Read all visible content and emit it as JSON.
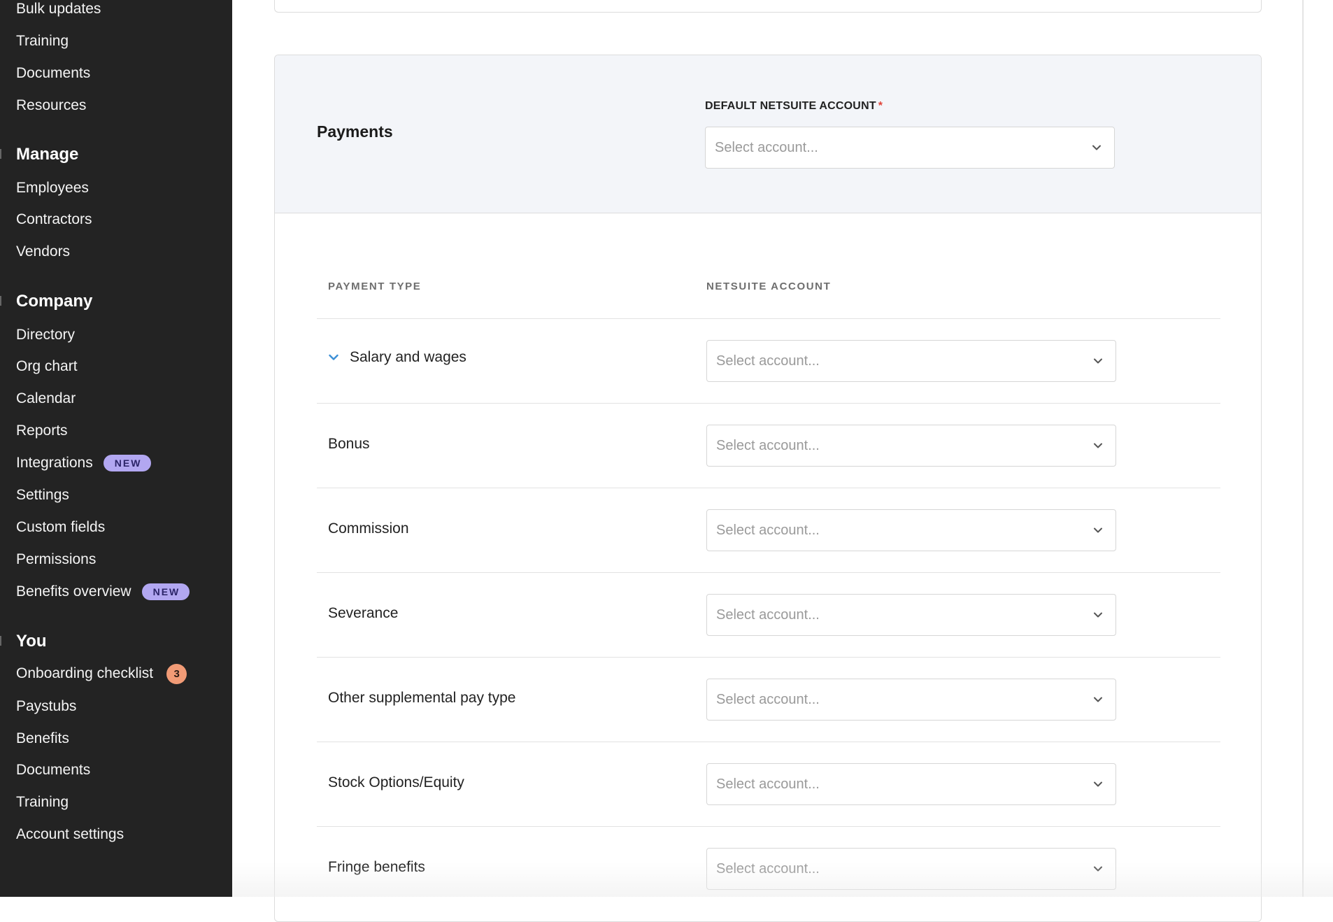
{
  "sidebar": {
    "top_items": [
      {
        "label": "Bulk updates"
      },
      {
        "label": "Training"
      },
      {
        "label": "Documents"
      },
      {
        "label": "Resources"
      }
    ],
    "manage": {
      "heading": "Manage",
      "items": [
        {
          "label": "Employees"
        },
        {
          "label": "Contractors"
        },
        {
          "label": "Vendors"
        }
      ]
    },
    "company": {
      "heading": "Company",
      "items": [
        {
          "label": "Directory"
        },
        {
          "label": "Org chart"
        },
        {
          "label": "Calendar"
        },
        {
          "label": "Reports"
        },
        {
          "label": "Integrations",
          "badge": "NEW"
        },
        {
          "label": "Settings"
        },
        {
          "label": "Custom fields"
        },
        {
          "label": "Permissions"
        },
        {
          "label": "Benefits overview",
          "badge": "NEW"
        }
      ]
    },
    "you": {
      "heading": "You",
      "items": [
        {
          "label": "Onboarding checklist",
          "count": "3"
        },
        {
          "label": "Paystubs"
        },
        {
          "label": "Benefits"
        },
        {
          "label": "Documents"
        },
        {
          "label": "Training"
        },
        {
          "label": "Account settings"
        }
      ]
    }
  },
  "payments": {
    "title": "Payments",
    "default_account_label": "DEFAULT NETSUITE ACCOUNT",
    "required_marker": "*",
    "default_account_placeholder": "Select account...",
    "columns": {
      "payment_type": "PAYMENT TYPE",
      "netsuite_account": "NETSUITE ACCOUNT"
    },
    "rows": [
      {
        "label": "Salary and wages",
        "expandable": true,
        "placeholder": "Select account..."
      },
      {
        "label": "Bonus",
        "placeholder": "Select account..."
      },
      {
        "label": "Commission",
        "placeholder": "Select account..."
      },
      {
        "label": "Severance",
        "placeholder": "Select account..."
      },
      {
        "label": "Other supplemental pay type",
        "placeholder": "Select account..."
      },
      {
        "label": "Stock Options/Equity",
        "placeholder": "Select account..."
      },
      {
        "label": "Fringe benefits",
        "placeholder": "Select account..."
      }
    ]
  },
  "colors": {
    "sidebar_bg": "#232323",
    "badge_new_bg": "#b2a7f1",
    "badge_count_bg": "#f19b76",
    "expand_chevron": "#3b8fd6",
    "required": "#e0453a"
  }
}
